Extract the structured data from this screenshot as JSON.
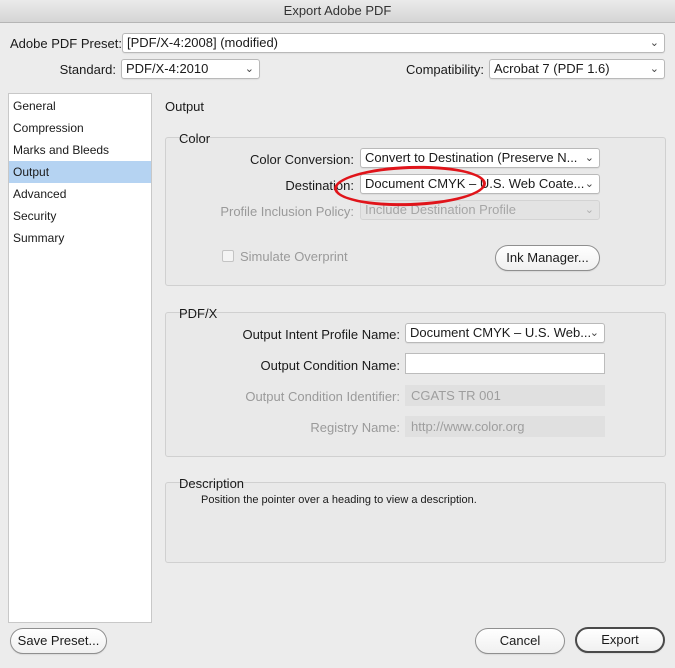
{
  "window": {
    "title": "Export Adobe PDF"
  },
  "preset": {
    "label": "Adobe PDF Preset:",
    "value": "[PDF/X-4:2008] (modified)"
  },
  "standard": {
    "label": "Standard:",
    "value": "PDF/X-4:2010"
  },
  "compatibility": {
    "label": "Compatibility:",
    "value": "Acrobat 7 (PDF 1.6)"
  },
  "sidebar": {
    "items": [
      {
        "label": "General"
      },
      {
        "label": "Compression"
      },
      {
        "label": "Marks and Bleeds"
      },
      {
        "label": "Output",
        "selected": true
      },
      {
        "label": "Advanced"
      },
      {
        "label": "Security"
      },
      {
        "label": "Summary"
      }
    ]
  },
  "panel": {
    "title": "Output"
  },
  "color": {
    "title": "Color",
    "conversion_label": "Color Conversion:",
    "conversion_value": "Convert to Destination (Preserve N...",
    "destination_label": "Destination:",
    "destination_value": "Document CMYK – U.S. Web Coate...",
    "profile_label": "Profile Inclusion Policy:",
    "profile_value": "Include Destination Profile",
    "simulate_label": "Simulate Overprint",
    "ink_manager_label": "Ink Manager..."
  },
  "pdfx": {
    "title": "PDF/X",
    "intent_label": "Output Intent Profile Name:",
    "intent_value": "Document CMYK – U.S. Web...",
    "condition_name_label": "Output Condition Name:",
    "condition_name_value": "",
    "condition_id_label": "Output Condition Identifier:",
    "condition_id_value": "CGATS TR 001",
    "registry_label": "Registry Name:",
    "registry_value": "http://www.color.org"
  },
  "description": {
    "title": "Description",
    "text": "Position the pointer over a heading to view a description."
  },
  "buttons": {
    "save_preset": "Save Preset...",
    "cancel": "Cancel",
    "export": "Export"
  },
  "colors": {
    "selection": "#b5d3f2",
    "annotation_ring": "#e0141a"
  }
}
